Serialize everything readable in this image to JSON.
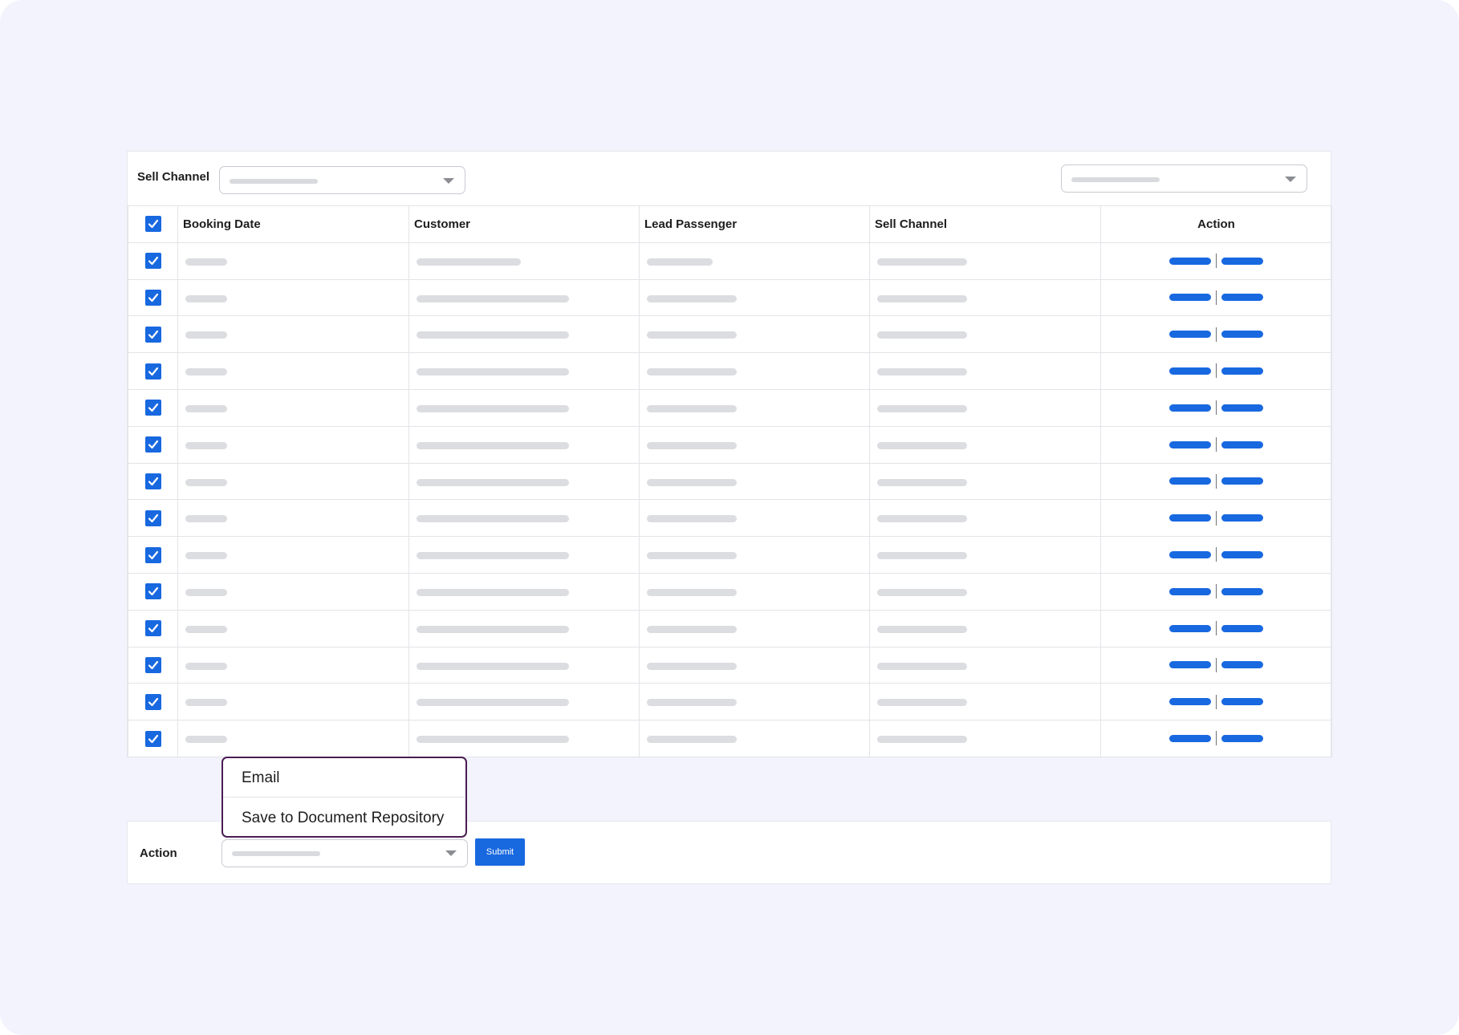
{
  "filter": {
    "sell_channel_label": "Sell Channel",
    "sell_channel_value": "",
    "right_select_value": ""
  },
  "table": {
    "columns": [
      "Booking Date",
      "Customer",
      "Lead Passenger",
      "Sell Channel",
      "Action"
    ],
    "header_checked": true,
    "row_count": 14,
    "rows_checked": [
      true,
      true,
      true,
      true,
      true,
      true,
      true,
      true,
      true,
      true,
      true,
      true,
      true,
      true
    ]
  },
  "dropdown_menu": {
    "items": [
      "Email",
      "Save to Document Repository"
    ]
  },
  "action_bar": {
    "label": "Action",
    "select_value": "",
    "submit_label": "Submit"
  },
  "colors": {
    "accent": "#1868e0",
    "menu_border": "#4b1d52",
    "background": "#f2f3fc"
  }
}
